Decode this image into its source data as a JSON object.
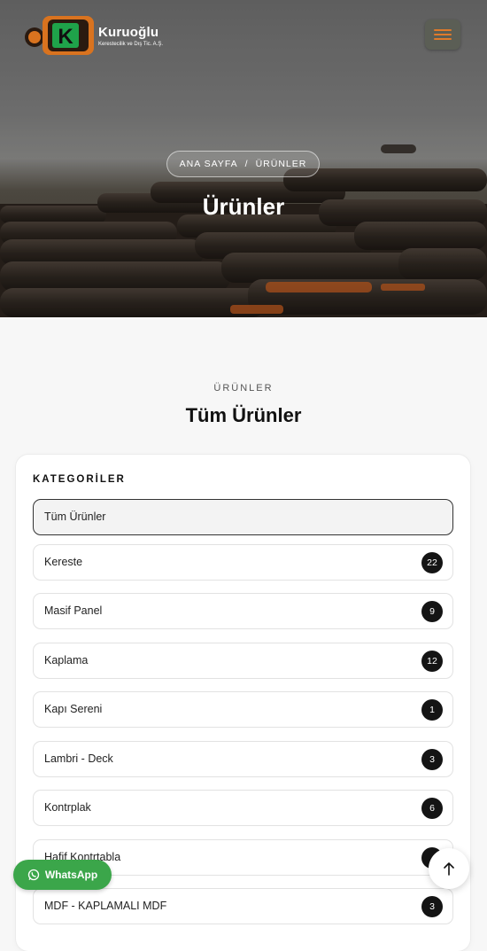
{
  "header": {
    "brand_name": "Kuruoğlu",
    "brand_subtitle": "Kerestecilik ve Dış Tic. A.Ş.",
    "logo_letter": "K",
    "menu_icon": "hamburger-icon"
  },
  "hero": {
    "breadcrumb": {
      "home": "ANA SAYFA",
      "separator": "/",
      "current": "ÜRÜNLER"
    },
    "title": "Ürünler"
  },
  "section": {
    "eyebrow": "ÜRÜNLER",
    "title": "Tüm Ürünler"
  },
  "categories": {
    "heading": "KATEGORİLER",
    "items": [
      {
        "label": "Tüm Ürünler",
        "count": "",
        "active": true
      },
      {
        "label": "Kereste",
        "count": "22"
      },
      {
        "label": "Masif Panel",
        "count": "9"
      },
      {
        "label": "Kaplama",
        "count": "12"
      },
      {
        "label": "Kapı Sereni",
        "count": "1"
      },
      {
        "label": "Lambri - Deck",
        "count": "3"
      },
      {
        "label": "Kontrplak",
        "count": "6"
      },
      {
        "label": "Hafif Kontrtabla",
        "count": ""
      },
      {
        "label": "MDF - KAPLAMALI MDF",
        "count": "3"
      }
    ]
  },
  "floating": {
    "whatsapp_label": "WhatsApp",
    "whatsapp_icon": "whatsapp-icon",
    "scroll_top_icon": "arrow-up-icon"
  },
  "colors": {
    "accent_orange": "#e07a2a",
    "whatsapp_green": "#3ba64a",
    "badge_dark": "#141414"
  }
}
